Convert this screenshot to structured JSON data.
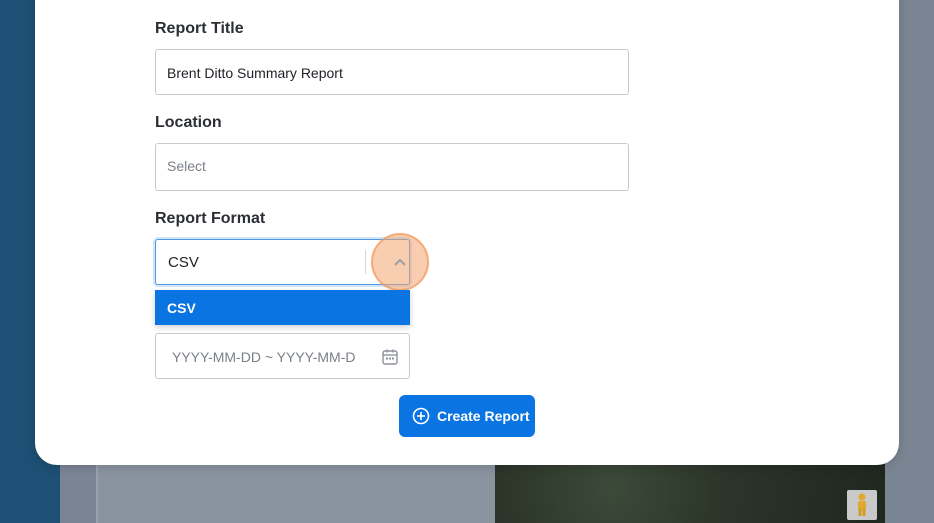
{
  "form": {
    "report_title_label": "Report Title",
    "report_title_value": "Brent Ditto Summary Report",
    "location_label": "Location",
    "location_placeholder": "Select",
    "report_format_label": "Report Format",
    "report_format_value": "CSV",
    "report_format_options": [
      "CSV"
    ],
    "date_range_placeholder": "YYYY-MM-DD ~ YYYY-MM-D",
    "create_button_label": "Create Report"
  },
  "icons": {
    "format_toggle": "chevron-up-icon",
    "date": "calendar-icon",
    "create": "plus-circle-icon",
    "map_person": "pegman-icon"
  },
  "colors": {
    "accent": "#0a74e2",
    "highlight": "#f4a46e"
  }
}
